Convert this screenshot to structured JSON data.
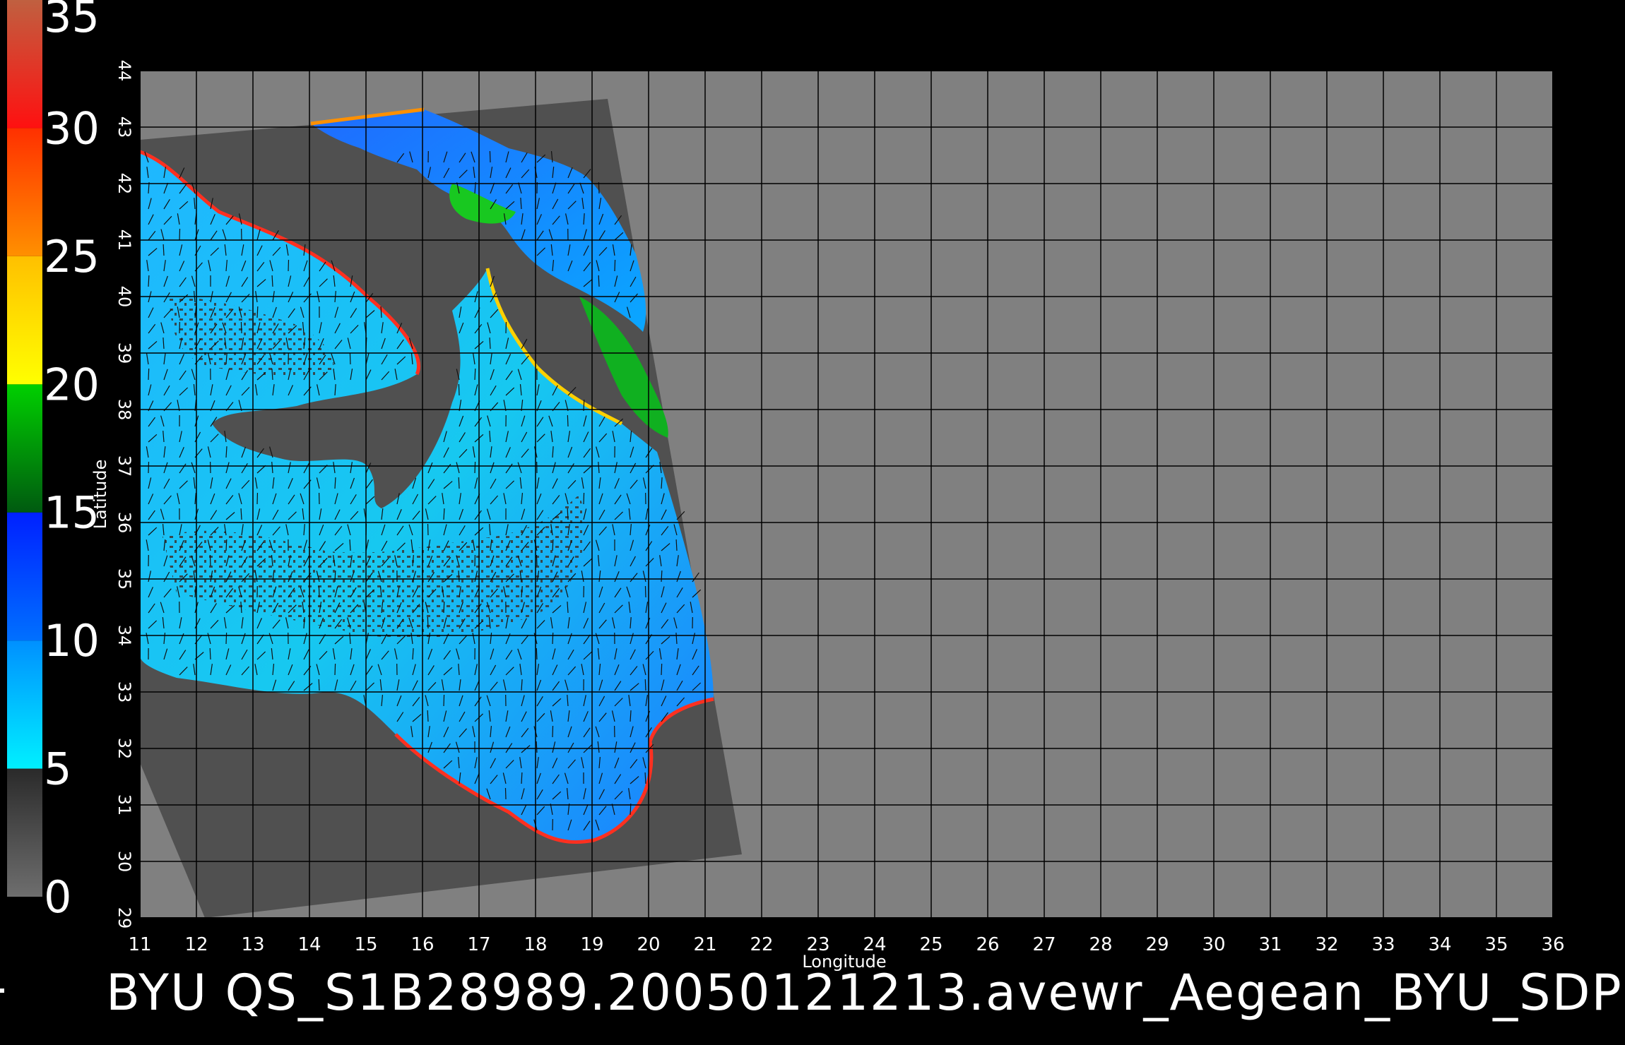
{
  "map": {
    "xlabel": "Longitude",
    "ylabel": "Latitude",
    "lon_range": [
      11,
      36
    ],
    "lat_range": [
      29,
      44
    ],
    "lon_ticks": [
      "11",
      "12",
      "13",
      "14",
      "15",
      "16",
      "17",
      "18",
      "19",
      "20",
      "21",
      "22",
      "23",
      "24",
      "25",
      "26",
      "27",
      "28",
      "29",
      "30",
      "31",
      "32",
      "33",
      "34",
      "35",
      "36"
    ],
    "lat_ticks": [
      "29",
      "30",
      "31",
      "32",
      "33",
      "34",
      "35",
      "36",
      "37",
      "38",
      "39",
      "40",
      "41",
      "42",
      "43",
      "44"
    ],
    "background_color": "#808080",
    "swath_color": "#505050"
  },
  "colorbar": {
    "labels": [
      "0",
      "5",
      "10",
      "15",
      "20",
      "25",
      "30",
      "35"
    ],
    "ticks": [
      0,
      5,
      10,
      15,
      20,
      25,
      30,
      35
    ],
    "segments": [
      {
        "from": 0,
        "to": 5,
        "colors": [
          "#6e6e6e",
          "#2a2a2a"
        ]
      },
      {
        "from": 5,
        "to": 10,
        "colors": [
          "#00f0ff",
          "#0090ff"
        ]
      },
      {
        "from": 10,
        "to": 15,
        "colors": [
          "#0070ff",
          "#0020ff"
        ]
      },
      {
        "from": 15,
        "to": 20,
        "colors": [
          "#005a10",
          "#00d000"
        ]
      },
      {
        "from": 20,
        "to": 25,
        "colors": [
          "#ffff00",
          "#ffc000"
        ]
      },
      {
        "from": 25,
        "to": 30,
        "colors": [
          "#ff9000",
          "#ff3000"
        ]
      },
      {
        "from": 30,
        "to": 35,
        "colors": [
          "#ff1010",
          "#c06040"
        ]
      }
    ]
  },
  "caption": "BYU  QS_S1B28989.20050121213.avewr_Aegean_BYU_SDP"
}
